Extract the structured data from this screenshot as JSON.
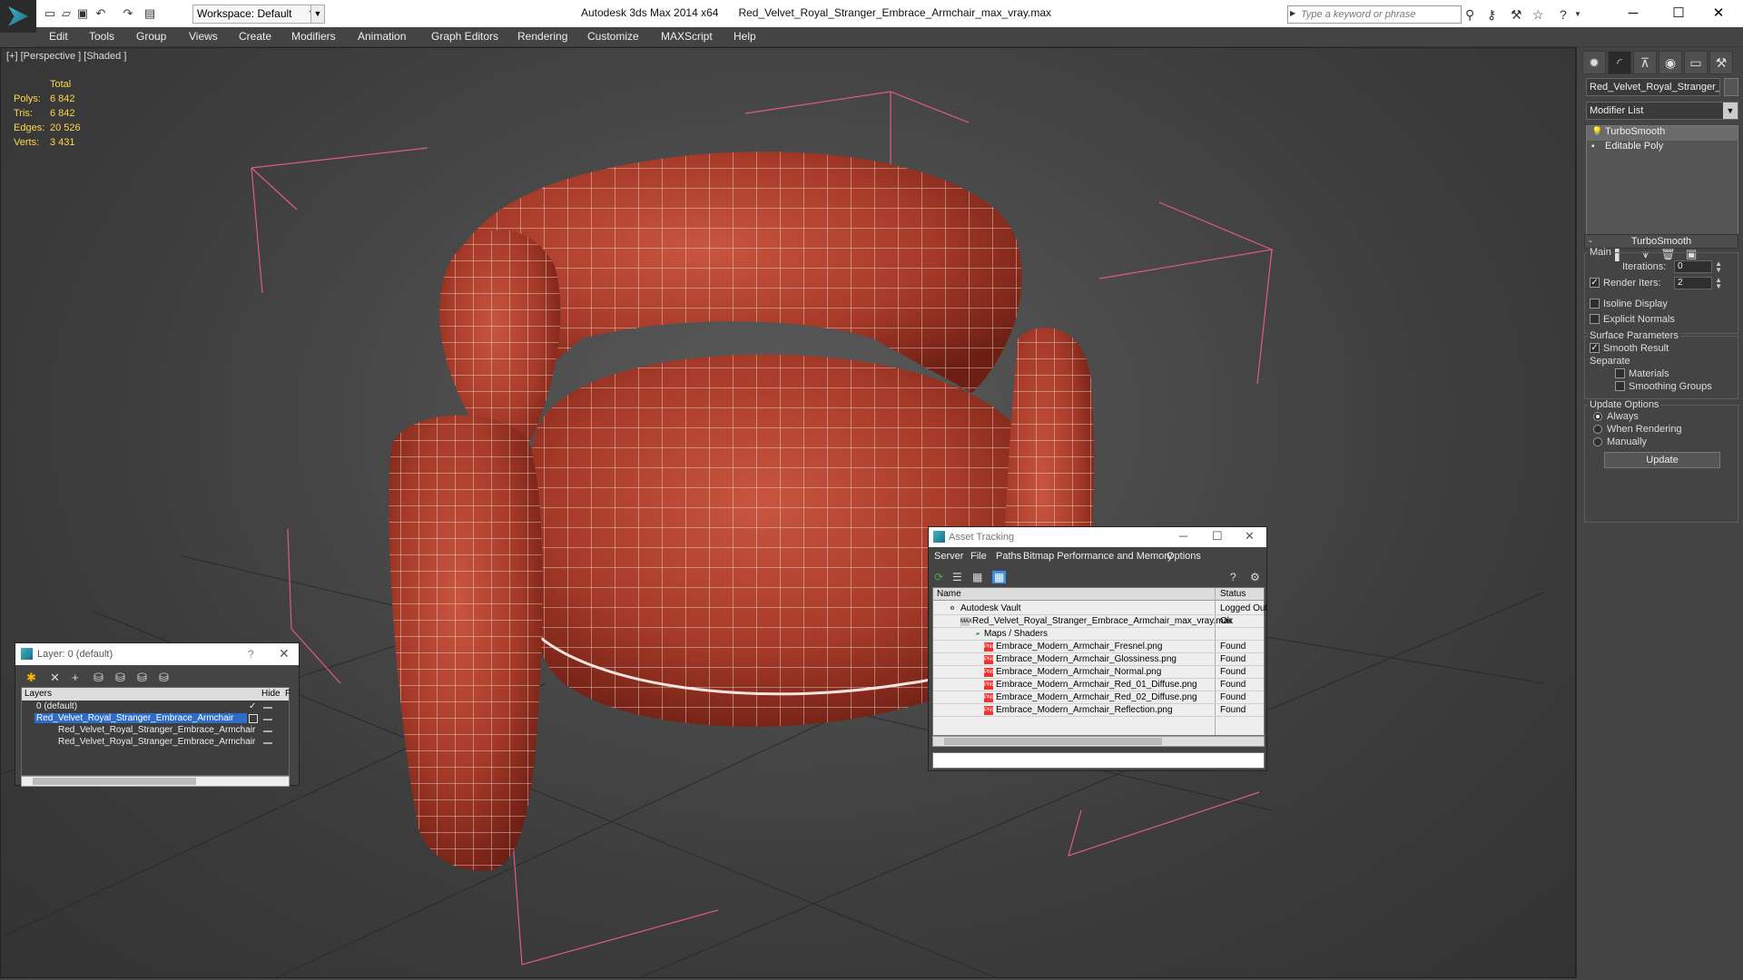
{
  "titlebar": {
    "workspace": "Workspace: Default",
    "app_name": "Autodesk 3ds Max  2014 x64",
    "file_name": "Red_Velvet_Royal_Stranger_Embrace_Armchair_max_vray.max",
    "search_placeholder": "Type a keyword or phrase"
  },
  "menu": [
    "Edit",
    "Tools",
    "Group",
    "Views",
    "Create",
    "Modifiers",
    "Animation",
    "Graph Editors",
    "Rendering",
    "Customize",
    "MAXScript",
    "Help"
  ],
  "viewport": {
    "label": "[+] [Perspective ] [Shaded ]",
    "stats": {
      "header": "Total",
      "rows": [
        {
          "k": "Polys:",
          "v": "6 842"
        },
        {
          "k": "Tris:",
          "v": "6 842"
        },
        {
          "k": "Edges:",
          "v": "20 526"
        },
        {
          "k": "Verts:",
          "v": "3 431"
        }
      ]
    }
  },
  "command_panel": {
    "object_name": "Red_Velvet_Royal_Stranger_",
    "modifier_list": "Modifier List",
    "stack": [
      "TurboSmooth",
      "Editable Poly"
    ],
    "rollout_title": "TurboSmooth",
    "main_group": "Main",
    "iterations_label": "Iterations:",
    "iterations_value": "0",
    "render_iters_label": "Render Iters:",
    "render_iters_value": "2",
    "isoline_label": "Isoline Display",
    "explicit_normals_label": "Explicit Normals",
    "surface_group": "Surface Parameters",
    "smooth_result_label": "Smooth Result",
    "separate_label": "Separate",
    "materials_label": "Materials",
    "smoothing_groups_label": "Smoothing Groups",
    "update_group": "Update Options",
    "always_label": "Always",
    "when_rendering_label": "When Rendering",
    "manually_label": "Manually",
    "update_button": "Update"
  },
  "layer_window": {
    "title": "Layer: 0 (default)",
    "col_layers": "Layers",
    "col_hide": "Hide",
    "col_f": "F",
    "rows": [
      "0 (default)",
      "Red_Velvet_Royal_Stranger_Embrace_Armchair",
      "Red_Velvet_Royal_Stranger_Embrace_Armchair",
      "Red_Velvet_Royal_Stranger_Embrace_Armchair"
    ]
  },
  "asset_window": {
    "title": "Asset Tracking",
    "menu": [
      "Server",
      "File",
      "Paths",
      "Bitmap Performance and Memory",
      "Options"
    ],
    "col_name": "Name",
    "col_status": "Status",
    "rows": [
      {
        "name": "Autodesk Vault",
        "status": "Logged Out"
      },
      {
        "name": "Red_Velvet_Royal_Stranger_Embrace_Armchair_max_vray.max",
        "status": "Ok"
      },
      {
        "name": "Maps / Shaders",
        "status": ""
      },
      {
        "name": "Embrace_Modern_Armchair_Fresnel.png",
        "status": "Found"
      },
      {
        "name": "Embrace_Modern_Armchair_Glossiness.png",
        "status": "Found"
      },
      {
        "name": "Embrace_Modern_Armchair_Normal.png",
        "status": "Found"
      },
      {
        "name": "Embrace_Modern_Armchair_Red_01_Diffuse.png",
        "status": "Found"
      },
      {
        "name": "Embrace_Modern_Armchair_Red_02_Diffuse.png",
        "status": "Found"
      },
      {
        "name": "Embrace_Modern_Armchair_Reflection.png",
        "status": "Found"
      }
    ]
  }
}
